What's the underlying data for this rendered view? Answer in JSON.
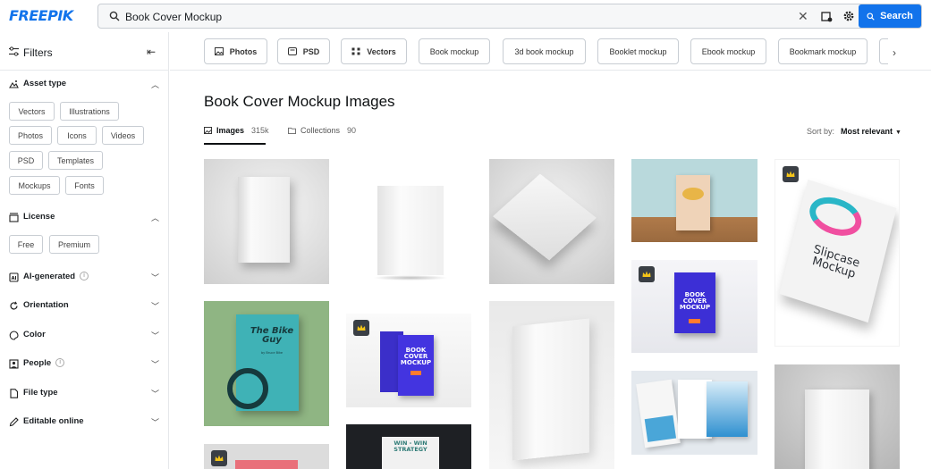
{
  "header": {
    "logo": "FREEPIK",
    "search_value": "Book Cover Mockup",
    "search_button": "Search"
  },
  "sidebar": {
    "title": "Filters",
    "asset_type": {
      "label": "Asset type",
      "chips": [
        "Vectors",
        "Illustrations",
        "Photos",
        "Icons",
        "Videos",
        "PSD",
        "Templates",
        "Mockups",
        "Fonts"
      ]
    },
    "license": {
      "label": "License",
      "chips": [
        "Free",
        "Premium"
      ]
    },
    "sections": [
      "AI-generated",
      "Orientation",
      "Color",
      "People",
      "File type",
      "Editable online"
    ]
  },
  "tags": [
    "Photos",
    "PSD",
    "Vectors",
    "Book mockup",
    "3d book mockup",
    "Booklet mockup",
    "Ebook mockup",
    "Bookmark mockup"
  ],
  "main": {
    "title": "Book Cover Mockup Images",
    "tabs": [
      {
        "label": "Images",
        "count": "315k"
      },
      {
        "label": "Collections",
        "count": "90"
      }
    ],
    "sort_label": "Sort by:",
    "sort_value": "Most relevant"
  },
  "card_texts": {
    "bike_title": "The Bike Guy",
    "bike_author": "by Bruce Bike",
    "book_cover_mockup": "BOOK COVER MOCKUP",
    "slipcase": "Slipcase Mockup",
    "win_win": "WIN - WIN STRATEGY"
  },
  "colors": {
    "brand": "#1273eb"
  }
}
